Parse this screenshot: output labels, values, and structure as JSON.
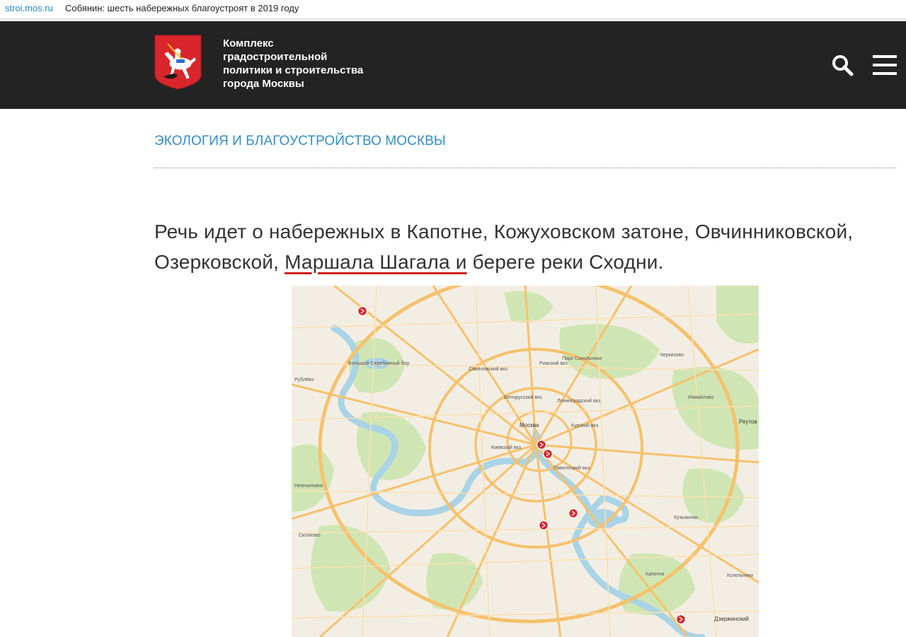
{
  "browser": {
    "domain": "stroi.mos.ru",
    "page_title": "Собянин: шесть набережных благоустроят в 2019 году"
  },
  "header": {
    "org_lines": [
      "Комплекс",
      "градостроительной",
      "политики и строительства",
      "города Москвы"
    ],
    "logo_icon": "moscow-coat-of-arms-icon",
    "search_icon": "search-icon",
    "menu_icon": "hamburger-menu-icon"
  },
  "category": "ЭКОЛОГИЯ И БЛАГОУСТРОЙСТВО МОСКВЫ",
  "article": {
    "text_before": "Речь идет о набережных в Капотне, Кожуховском затоне, Овчинниковской, Озерковской, ",
    "text_highlight": "Маршала Шагала и",
    "text_after": " береге реки Сходни."
  },
  "map": {
    "labels": {
      "moscow": "Москва",
      "reutov": "Реутов",
      "dzerzhinsky": "Дзержинский",
      "kotelniki": "Котельники",
      "krasnogorsk_area": "Рублёво",
      "sokolniki": "Парк Сокольники",
      "kurskiy": "Курский вкз.",
      "kievskiy": "Киевский вкз.",
      "paveletskiy": "Павелецкий вкз.",
      "leningradskiy": "Ленинградский вкз.",
      "belorusskiy": "Белорусский вкз.",
      "savelovskiy": "Савёловский вкз.",
      "rizhskiy": "Рижский вкз.",
      "serebryany_bor": "Большой Серебряный бор",
      "odintsovo": "Немчиновка",
      "skolkovo": "Сколково",
      "izmailovo": "Измайлово",
      "cherkizovo": "Черкизово",
      "kuzminki": "Кузьминки",
      "kapotnya": "Капотня"
    },
    "marker_icon": "embankment-marker-icon",
    "colors": {
      "land": "#f3eee4",
      "park": "#cfe6b4",
      "water": "#a9d3e6",
      "road_major": "#f6c16c",
      "road_minor": "#fbe0b0",
      "marker": "#d8262c"
    }
  }
}
